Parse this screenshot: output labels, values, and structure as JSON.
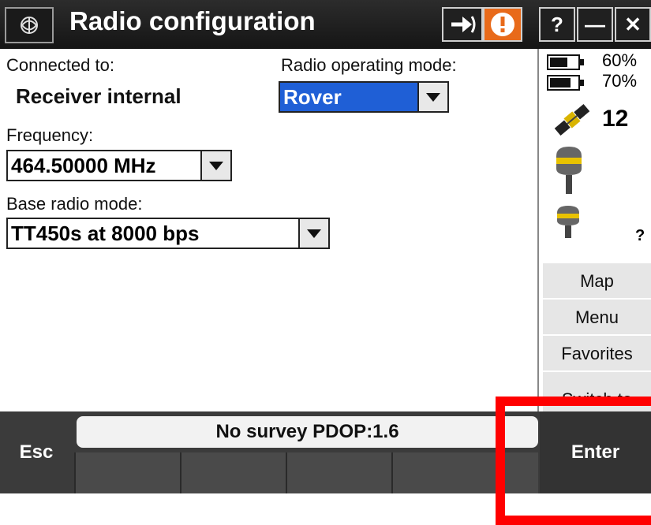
{
  "titlebar": {
    "title": "Radio configuration",
    "buttons": {
      "help": "?",
      "minimize": "—",
      "close": "✕"
    },
    "warning_color": "#e86a1a"
  },
  "form": {
    "connected_label": "Connected to:",
    "connected_value": "Receiver internal",
    "mode_label": "Radio operating mode:",
    "mode_value": "Rover",
    "frequency_label": "Frequency:",
    "frequency_value": "464.50000 MHz",
    "base_label": "Base radio mode:",
    "base_value": "TT450s at 8000 bps"
  },
  "status_panel": {
    "battery1": "60%",
    "battery2": "70%",
    "satellites": "12",
    "unknown_receiver": "?"
  },
  "side_menu": {
    "map": "Map",
    "menu": "Menu",
    "favorites": "Favorites",
    "switch_to": "Switch to"
  },
  "bottom": {
    "esc": "Esc",
    "enter": "Enter",
    "status": "No survey  PDOP:1.6"
  },
  "colors": {
    "highlight": "#1f5fd6",
    "annotation": "#ff0000"
  }
}
